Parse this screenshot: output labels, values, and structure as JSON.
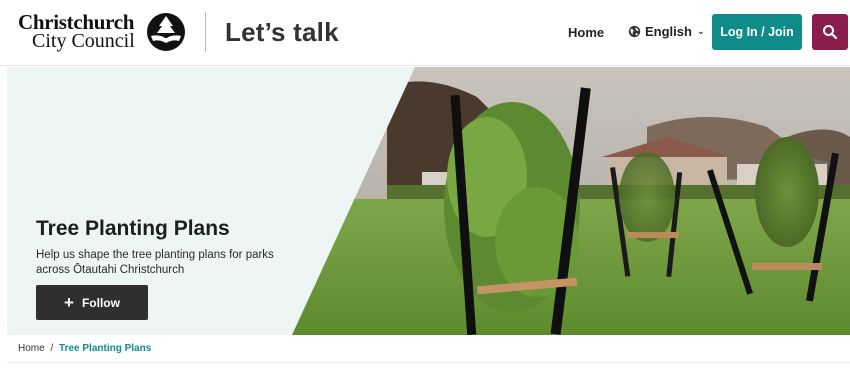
{
  "header": {
    "logo_line1": "Christchurch",
    "logo_line2": "City Council",
    "app_title": "Let’s talk",
    "nav_home": "Home",
    "language": "English",
    "login_label": "Log In / Join",
    "icons": {
      "logo": "council-emblem-icon",
      "language": "globe-icon",
      "language_toggle": "chevron-down-icon",
      "search": "search-icon",
      "follow": "plus-icon"
    },
    "colors": {
      "login_bg": "#0f8c8a",
      "search_bg": "#8b1c4e"
    }
  },
  "hero": {
    "title": "Tree Planting Plans",
    "subtitle": "Help us shape the tree planting plans for parks across Ōtautahi Christchurch",
    "follow_label": "Follow",
    "follow_icon": "+"
  },
  "breadcrumb": {
    "home": "Home",
    "separator": "/",
    "current": "Tree Planting Plans"
  }
}
